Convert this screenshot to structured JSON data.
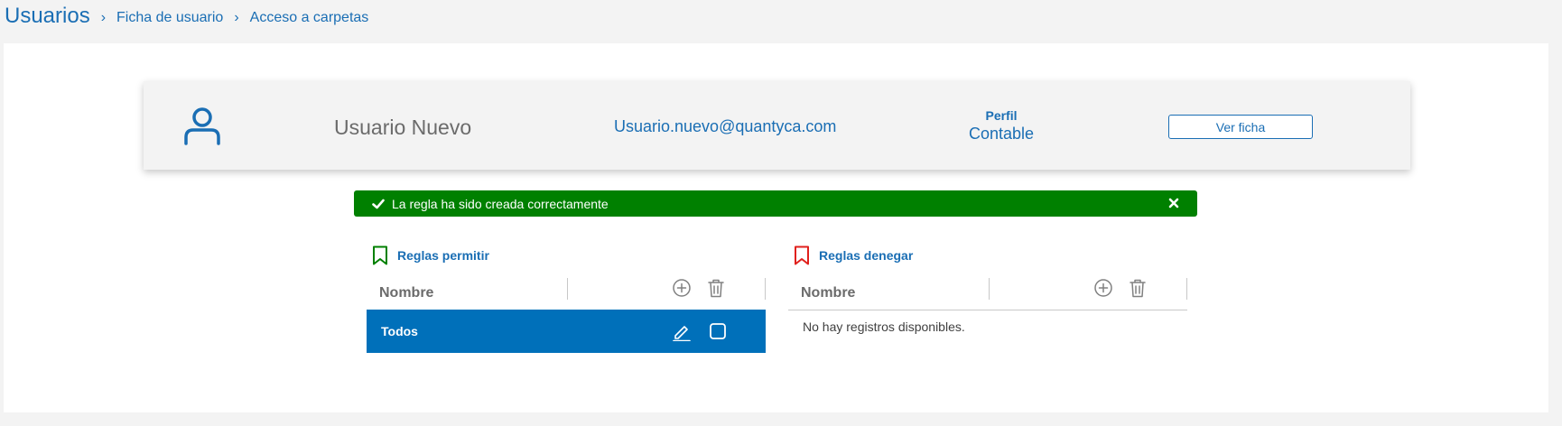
{
  "breadcrumb": {
    "root": "Usuarios",
    "items": [
      "Ficha de usuario",
      "Acceso a carpetas"
    ],
    "separator": "›"
  },
  "user": {
    "icon": "user-icon",
    "name": "Usuario Nuevo",
    "email": "Usuario.nuevo@quantyca.com",
    "profile_label": "Perfil",
    "profile_value": "Contable",
    "view_button": "Ver ficha"
  },
  "alert": {
    "message": "La regla ha sido creada correctamente",
    "color": "#008000",
    "icons": [
      "check-icon",
      "close-icon"
    ]
  },
  "allow_rules": {
    "title": "Reglas permitir",
    "icon": "bookmark-icon",
    "icon_color": "#008000",
    "column_name": "Nombre",
    "header_icons": [
      "add-circle-icon",
      "trash-icon"
    ],
    "rows": [
      {
        "label": "Todos",
        "icons": [
          "edit-icon",
          "checkbox-icon"
        ],
        "selected": true
      }
    ]
  },
  "deny_rules": {
    "title": "Reglas denegar",
    "icon": "bookmark-icon",
    "icon_color": "#e0201c",
    "column_name": "Nombre",
    "header_icons": [
      "add-circle-icon",
      "trash-icon"
    ],
    "empty_message": "No hay registros disponibles."
  },
  "colors": {
    "accent": "#1a6eb4",
    "selected_row": "#0070ba",
    "background": "#f3f3f3"
  }
}
